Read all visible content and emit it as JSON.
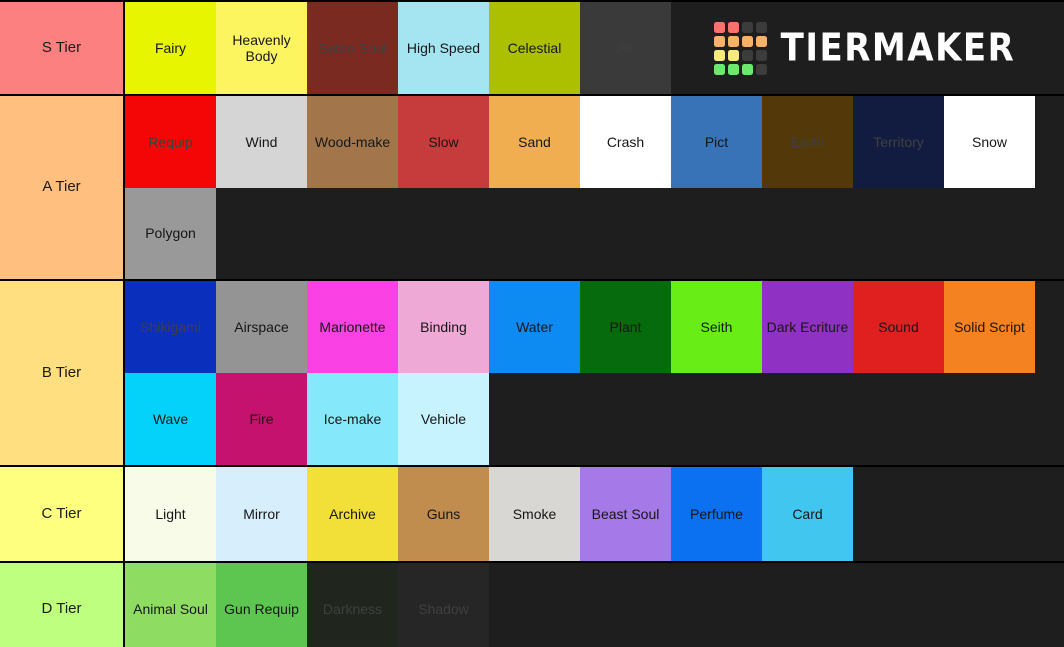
{
  "app": {
    "brand_name": "TIERMAKER",
    "background_color": "#1e1e1e",
    "divider_color": "#000000"
  },
  "logo": {
    "name": "tiermaker-logo",
    "grid_colors": [
      [
        "#f8736e",
        "#f8736e",
        "#3c3c3c",
        "#3c3c3c"
      ],
      [
        "#f7b26a",
        "#f7b26a",
        "#f7b26a",
        "#f7b26a"
      ],
      [
        "#f6ea7a",
        "#f6ea7a",
        "#3c3c3c",
        "#3c3c3c"
      ],
      [
        "#6ce86c",
        "#6ce86c",
        "#6ce86c",
        "#3c3c3c"
      ]
    ]
  },
  "tiers": [
    {
      "label": "S Tier",
      "label_color": "#fd8080",
      "rows": [
        [
          {
            "label": "Fairy",
            "color": "#e8f500"
          },
          {
            "label": "Heavenly Body",
            "color": "#fcf55f"
          },
          {
            "label": "Satan Soul",
            "color": "#7b2a22"
          },
          {
            "label": "High Speed",
            "color": "#a5e5f2"
          },
          {
            "label": "Celestial",
            "color": "#adc000"
          },
          {
            "label": "Air",
            "color": "#3a3a3a"
          }
        ]
      ]
    },
    {
      "label": "A Tier",
      "label_color": "#ffbf7f",
      "rows": [
        [
          {
            "label": "Requip",
            "color": "#f50606"
          },
          {
            "label": "Wind",
            "color": "#d5d5d5"
          },
          {
            "label": "Wood-make",
            "color": "#a2764a"
          },
          {
            "label": "Slow",
            "color": "#c63c3c"
          },
          {
            "label": "Sand",
            "color": "#f0ae51"
          },
          {
            "label": "Crash",
            "color": "#ffffff"
          },
          {
            "label": "Pict",
            "color": "#3873b8"
          },
          {
            "label": "Earth",
            "color": "#53390a"
          },
          {
            "label": "Territory",
            "color": "#121c40"
          },
          {
            "label": "Snow",
            "color": "#ffffff"
          }
        ],
        [
          {
            "label": "Polygon",
            "color": "#999999"
          }
        ]
      ]
    },
    {
      "label": "B Tier",
      "label_color": "#ffdf80",
      "rows": [
        [
          {
            "label": "Shikigami",
            "color": "#0a2fbd"
          },
          {
            "label": "Airspace",
            "color": "#949494"
          },
          {
            "label": "Marionette",
            "color": "#fa41e3"
          },
          {
            "label": "Binding",
            "color": "#eea9d6"
          },
          {
            "label": "Water",
            "color": "#0d8bf2"
          },
          {
            "label": "Plant",
            "color": "#066b0d"
          },
          {
            "label": "Seith",
            "color": "#68ed17"
          },
          {
            "label": "Dark Ecriture",
            "color": "#8f32c4"
          },
          {
            "label": "Sound",
            "color": "#e01f1f"
          },
          {
            "label": "Solid Script",
            "color": "#f58220"
          }
        ],
        [
          {
            "label": "Wave",
            "color": "#04d2fb"
          },
          {
            "label": "Fire",
            "color": "#c5126e"
          },
          {
            "label": "Ice-make",
            "color": "#85e9fb"
          },
          {
            "label": "Vehicle",
            "color": "#c6f3fd"
          }
        ]
      ]
    },
    {
      "label": "C Tier",
      "label_color": "#ffff7f",
      "rows": [
        [
          {
            "label": "Light",
            "color": "#f8fbe8"
          },
          {
            "label": "Mirror",
            "color": "#d7effc"
          },
          {
            "label": "Archive",
            "color": "#f2e038"
          },
          {
            "label": "Guns",
            "color": "#c08d4f"
          },
          {
            "label": "Smoke",
            "color": "#d8d7d3"
          },
          {
            "label": "Beast Soul",
            "color": "#a579e7"
          },
          {
            "label": "Perfume",
            "color": "#0c71f0"
          },
          {
            "label": "Card",
            "color": "#41c6ef"
          }
        ]
      ]
    },
    {
      "label": "D Tier",
      "label_color": "#bfff7f",
      "rows": [
        [
          {
            "label": "Animal Soul",
            "color": "#8fdc63"
          },
          {
            "label": "Gun Requip",
            "color": "#5cc council"
          },
          {
            "label": "Darkness",
            "color": "#20261e"
          },
          {
            "label": "Shadow",
            "color": "#262626"
          }
        ]
      ]
    }
  ]
}
